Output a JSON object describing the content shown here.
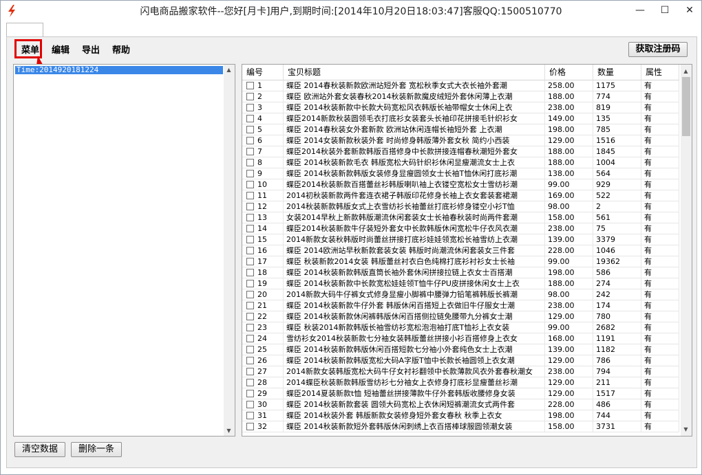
{
  "window": {
    "title": "闪电商品搬家软件--您好[月卡]用户,到期时间:[2014年10月20日18:03:47]客服QQ:1500510770",
    "minimize_glyph": "—",
    "maximize_glyph": "☐",
    "close_glyph": "✕",
    "app_icon": "lightning-icon",
    "accent_color": "#e00000"
  },
  "menu": {
    "items": [
      "菜单",
      "编辑",
      "导出",
      "帮助"
    ]
  },
  "toolbar": {
    "register_button": "获取注册码"
  },
  "left_list": {
    "items": [
      "Time:2014920181224"
    ]
  },
  "grid": {
    "columns": [
      "编号",
      "宝贝标题",
      "价格",
      "数量",
      "属性"
    ],
    "rows": [
      {
        "no": "1",
        "title": "蝶臣 2014春秋装新款欧洲站短外套 宽松秋季女式大衣长袖外套潮",
        "price": "258.00",
        "qty": "1175",
        "attr": "有"
      },
      {
        "no": "2",
        "title": "蝶臣 欧洲站外套女装春秋2014秋装新款魔皮绒短外套休闲薄上衣潮",
        "price": "188.00",
        "qty": "774",
        "attr": "有"
      },
      {
        "no": "3",
        "title": "蝶臣 2014秋装新款中长款大码宽松风衣韩版长袖带帽女士休闲上衣",
        "price": "238.00",
        "qty": "819",
        "attr": "有"
      },
      {
        "no": "4",
        "title": "蝶臣2014新款秋装圆领毛衣打底衫女装套头长袖印花拼接毛针织衫女",
        "price": "149.00",
        "qty": "135",
        "attr": "有"
      },
      {
        "no": "5",
        "title": "蝶臣 2014春秋装女外套新款 欧洲站休闲连帽长袖短外套 上衣潮",
        "price": "198.00",
        "qty": "785",
        "attr": "有"
      },
      {
        "no": "6",
        "title": "蝶臣 2014女装新款秋装外套 时尚修身韩版薄外套女秋 简约小西装",
        "price": "129.00",
        "qty": "1516",
        "attr": "有"
      },
      {
        "no": "7",
        "title": "蝶臣2014秋装外套新款韩版百搭修身中长款拼接连帽春秋潮短外套女",
        "price": "188.00",
        "qty": "1845",
        "attr": "有"
      },
      {
        "no": "8",
        "title": "蝶臣 2014秋装新款毛衣 韩版宽松大码针织衫休闲显瘦潮流女士上衣",
        "price": "188.00",
        "qty": "1004",
        "attr": "有"
      },
      {
        "no": "9",
        "title": "蝶臣 2014秋装新款韩版女装修身显瘦圆领女士长袖T恤休闲打底衫潮",
        "price": "138.00",
        "qty": "564",
        "attr": "有"
      },
      {
        "no": "10",
        "title": "蝶臣2014秋装新款百搭蕾丝衫韩版喇叭袖上衣镂空宽松女士雪纺衫潮",
        "price": "99.00",
        "qty": "929",
        "attr": "有"
      },
      {
        "no": "11",
        "title": "2014初秋装新款两件套连衣裙子韩版印花修身长袖上衣女套装套裙潮",
        "price": "169.00",
        "qty": "522",
        "attr": "有"
      },
      {
        "no": "12",
        "title": "2014秋装新款韩版女式上衣雪纺衫长袖蕾丝打底衫修身镂空小衫T恤",
        "price": "98.00",
        "qty": "2",
        "attr": "有"
      },
      {
        "no": "13",
        "title": "女装2014早秋上新款韩版潮流休闲套装女士长袖春秋装时尚两件套潮",
        "price": "158.00",
        "qty": "561",
        "attr": "有"
      },
      {
        "no": "14",
        "title": "蝶臣2014秋装新款牛仔装短外套女中长款韩版休闲宽松牛仔衣风衣潮",
        "price": "238.00",
        "qty": "75",
        "attr": "有"
      },
      {
        "no": "15",
        "title": "2014新款女装秋韩版时尚蕾丝拼接打底衫娃娃领宽松长袖雪纺上衣潮",
        "price": "139.00",
        "qty": "3379",
        "attr": "有"
      },
      {
        "no": "16",
        "title": "蝶臣 2014欧洲站早秋新款套装女装 韩版时尚潮流休闲套装女三件套",
        "price": "228.00",
        "qty": "1046",
        "attr": "有"
      },
      {
        "no": "17",
        "title": "蝶臣 秋装新款2014女装 韩版蕾丝衬衣白色纯棉打底衫衬衫女士长袖",
        "price": "99.00",
        "qty": "19362",
        "attr": "有"
      },
      {
        "no": "18",
        "title": "蝶臣 2014秋装新款韩版直筒长袖外套休闲拼接拉链上衣女士百搭潮",
        "price": "198.00",
        "qty": "586",
        "attr": "有"
      },
      {
        "no": "19",
        "title": "蝶臣 2014秋装新款中长款宽松娃娃领T恤牛仔PU皮拼接休闲女士上衣",
        "price": "188.00",
        "qty": "274",
        "attr": "有"
      },
      {
        "no": "20",
        "title": "2014新款大码牛仔裤女式修身显瘦小脚裤中腰弹力铅笔裤韩版长裤潮",
        "price": "98.00",
        "qty": "242",
        "attr": "有"
      },
      {
        "no": "21",
        "title": "蝶臣 2014秋装新款牛仔外套 韩版休闲百搭短上衣做旧牛仔服女士潮",
        "price": "238.00",
        "qty": "174",
        "attr": "有"
      },
      {
        "no": "22",
        "title": "蝶臣 2014秋装新款休闲裤韩版休闲百搭侧拉链免腰带九分裤女士潮",
        "price": "129.00",
        "qty": "780",
        "attr": "有"
      },
      {
        "no": "23",
        "title": "蝶臣 秋装2014新款韩版长袖雪纺衫宽松泡泡袖打底T恤衫上衣女装",
        "price": "99.00",
        "qty": "2682",
        "attr": "有"
      },
      {
        "no": "24",
        "title": "雪纺衫女2014秋装新款七分袖女装韩版蕾丝拼接小衫百搭修身上衣女",
        "price": "168.00",
        "qty": "1191",
        "attr": "有"
      },
      {
        "no": "25",
        "title": "蝶臣 2014秋装新款韩版休闲百搭短款七分袖小外套纯色女士上衣潮",
        "price": "139.00",
        "qty": "1182",
        "attr": "有"
      },
      {
        "no": "26",
        "title": "蝶臣 2014秋装新款韩版宽松大码A字版T恤中长款长袖圆领上衣女潮",
        "price": "129.00",
        "qty": "786",
        "attr": "有"
      },
      {
        "no": "27",
        "title": "2014新款女装韩版宽松大码牛仔女衬衫翻领中长款薄款风衣外套春秋潮女",
        "price": "238.00",
        "qty": "794",
        "attr": "有"
      },
      {
        "no": "28",
        "title": "2014蝶臣秋装新款韩版雪纺衫七分袖女上衣修身打底衫显瘦蕾丝衫潮",
        "price": "129.00",
        "qty": "211",
        "attr": "有"
      },
      {
        "no": "29",
        "title": "蝶臣2014夏装新款t恤 短袖蕾丝拼接薄款牛仔外套韩版收腰修身女装",
        "price": "129.00",
        "qty": "1517",
        "attr": "有"
      },
      {
        "no": "30",
        "title": "蝶臣 2014秋装新款套装 圆领大码宽松上衣休闲短裤潮流女式两件套",
        "price": "228.00",
        "qty": "486",
        "attr": "有"
      },
      {
        "no": "31",
        "title": "蝶臣 2014秋装外套 韩版新款女装修身短外套女春秋 秋季上衣女",
        "price": "198.00",
        "qty": "744",
        "attr": "有"
      },
      {
        "no": "32",
        "title": "蝶臣 2014秋装新款短外套韩版休闲刺绣上衣百搭棒球服圆领潮女装",
        "price": "158.00",
        "qty": "3731",
        "attr": "有"
      }
    ]
  },
  "bottom": {
    "clear_button": "清空数据",
    "delete_button": "删除一条"
  }
}
